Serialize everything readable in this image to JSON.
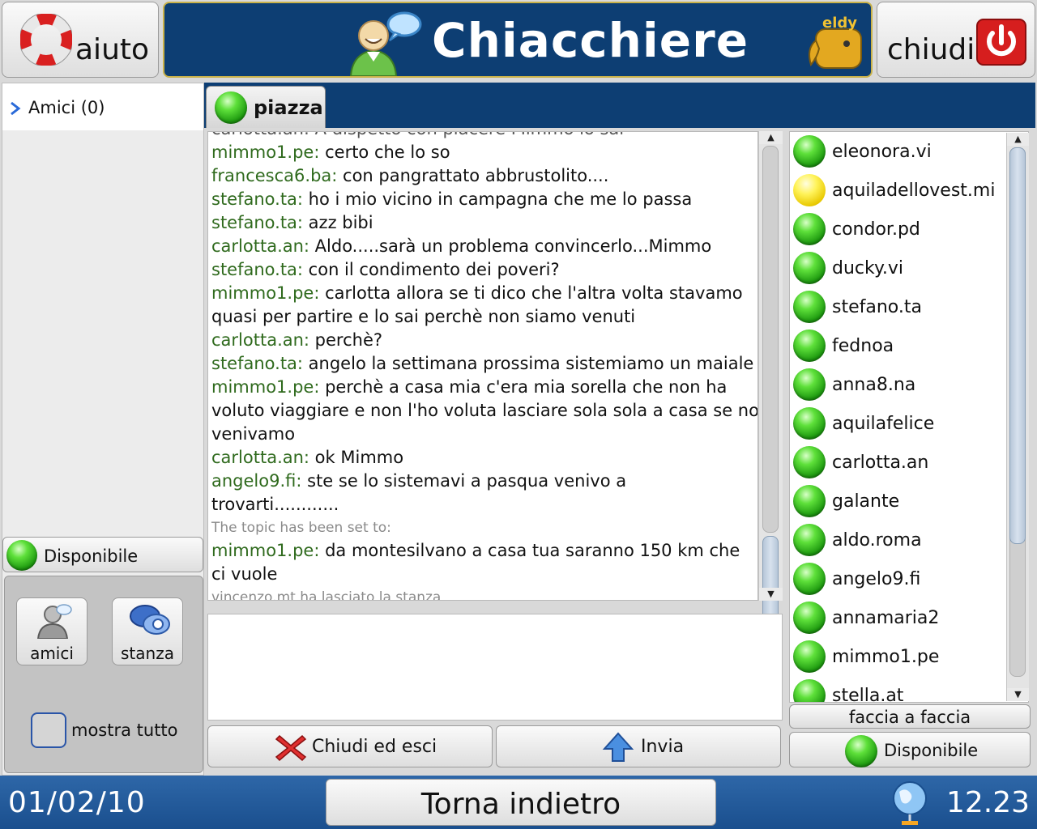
{
  "header": {
    "help_label": "aiuto",
    "title": "Chiacchiere",
    "close_label": "chiudi",
    "logo_text": "eldy"
  },
  "sidebar": {
    "friends_label": "Amici (0)",
    "status_label": "Disponibile",
    "friends_btn": "amici",
    "room_btn": "stanza",
    "show_all_label": "mostra tutto"
  },
  "tab": {
    "label": "piazza"
  },
  "chat": {
    "partial_line": "carlotta.an: A dispetto con piacere Mimmo lo sai",
    "messages": [
      {
        "nick": "mimmo1.pe:",
        "text": " certo che lo so"
      },
      {
        "nick": "francesca6.ba:",
        "text": " con pangrattato abbrustolito...."
      },
      {
        "nick": "stefano.ta:",
        "text": " ho i mio vicino in campagna che me lo passa"
      },
      {
        "nick": "stefano.ta:",
        "text": " azz bibi"
      },
      {
        "nick": "carlotta.an:",
        "text": " Aldo.....sarà un problema convincerlo...Mimmo"
      },
      {
        "nick": "stefano.ta:",
        "text": " con il condimento dei poveri?"
      },
      {
        "nick": "mimmo1.pe:",
        "text": " carlotta allora se ti dico che l'altra volta stavamo quasi per partire e lo sai perchè non siamo venuti"
      },
      {
        "nick": "carlotta.an:",
        "text": " perchè?"
      },
      {
        "nick": "stefano.ta:",
        "text": " angelo la settimana prossima sistemiamo un maiale"
      },
      {
        "nick": "mimmo1.pe:",
        "text": " perchè a casa mia c'era mia sorella che non ha voluto viaggiare e non l'ho voluta lasciare sola sola a casa se no venivamo"
      },
      {
        "nick": "carlotta.an:",
        "text": " ok Mimmo"
      },
      {
        "nick": "angelo9.fi:",
        "text": " ste se lo sistemavi a pasqua venivo a trovarti............"
      }
    ],
    "topic_notice": "The topic has been set to:",
    "last_message": {
      "nick": "mimmo1.pe:",
      "text": " da montesilvano a casa tua saranno 150 km che ci vuole"
    },
    "leave_notice": "vincenzo.mt ha lasciato la stanza"
  },
  "actions": {
    "exit_label": "Chiudi ed esci",
    "send_label": "Invia"
  },
  "users": [
    {
      "name": "eleonora.vi",
      "status": "green"
    },
    {
      "name": "aquiladellovest.mi",
      "status": "yellow"
    },
    {
      "name": "condor.pd",
      "status": "green"
    },
    {
      "name": "ducky.vi",
      "status": "green"
    },
    {
      "name": "stefano.ta",
      "status": "green"
    },
    {
      "name": "fednoa",
      "status": "green"
    },
    {
      "name": "anna8.na",
      "status": "green"
    },
    {
      "name": "aquilafelice",
      "status": "green"
    },
    {
      "name": "carlotta.an",
      "status": "green"
    },
    {
      "name": "galante",
      "status": "green"
    },
    {
      "name": "aldo.roma",
      "status": "green"
    },
    {
      "name": "angelo9.fi",
      "status": "green"
    },
    {
      "name": "annamaria2",
      "status": "green"
    },
    {
      "name": "mimmo1.pe",
      "status": "green"
    },
    {
      "name": "stella.at",
      "status": "green"
    }
  ],
  "right_panel": {
    "face_to_face_label": "faccia a faccia",
    "status_label": "Disponibile"
  },
  "footer": {
    "date": "01/02/10",
    "back_label": "Torna indietro",
    "time": "12.23"
  },
  "colors": {
    "nick_green": "#2f6a1d",
    "header_blue": "#0d3e73",
    "footer_blue": "#1f5796"
  }
}
